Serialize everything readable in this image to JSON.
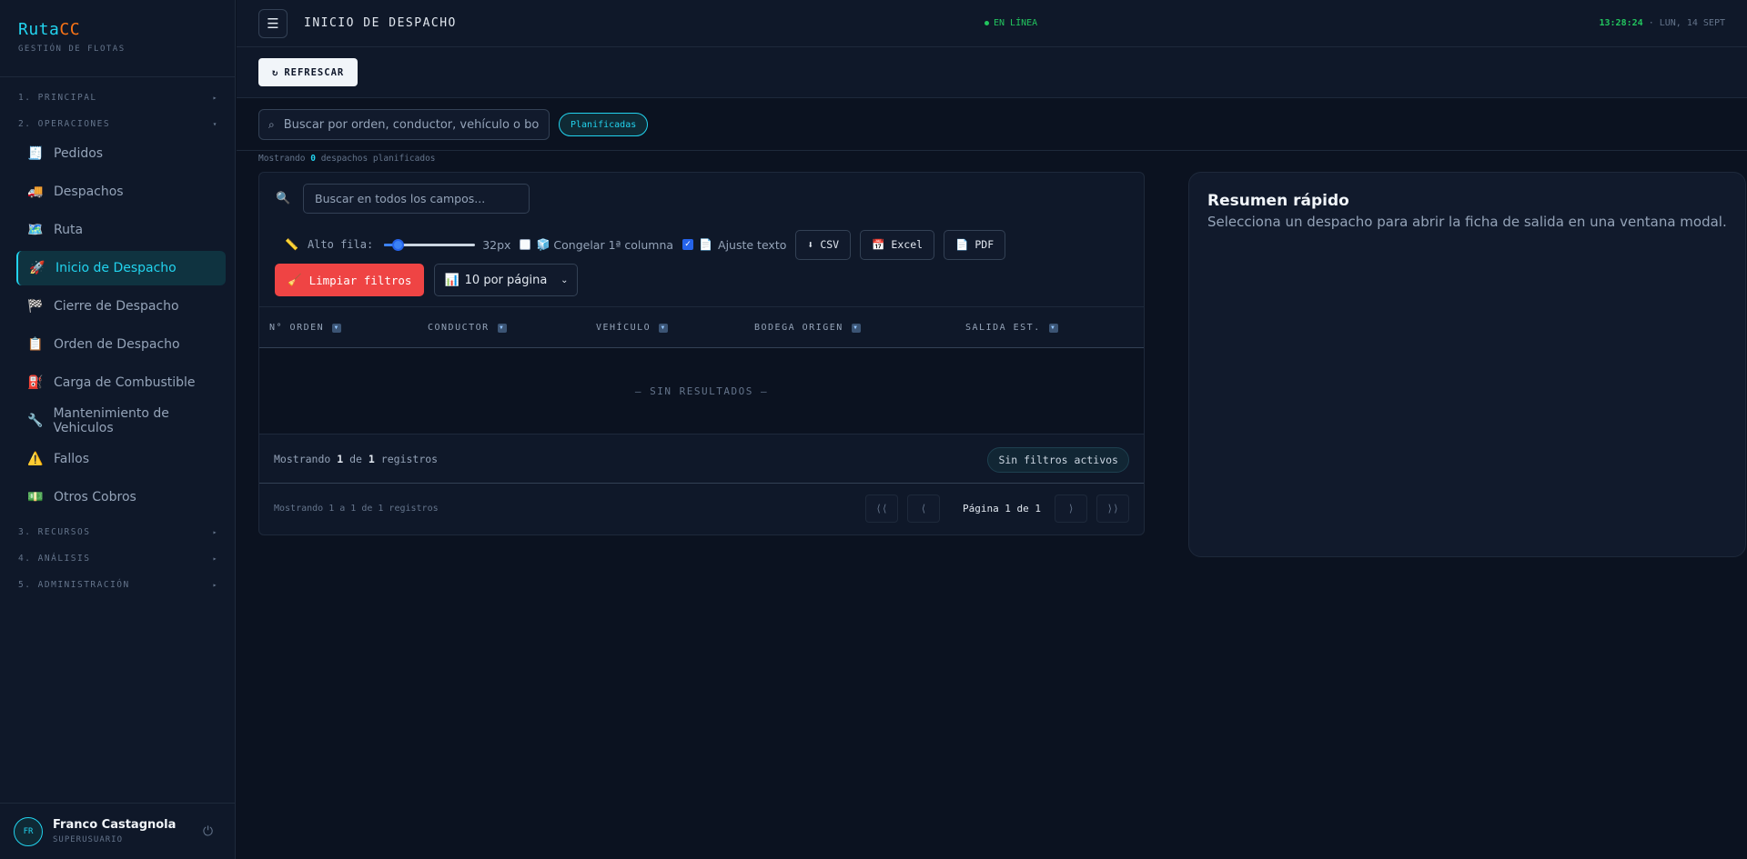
{
  "brand": {
    "name_a": "Ruta",
    "name_b": "CC",
    "subtitle": "GESTIÓN DE FLOTAS"
  },
  "sidebar": {
    "sections": [
      {
        "label": "1. PRINCIPAL",
        "arrow": "▸"
      },
      {
        "label": "2. OPERACIONES",
        "arrow": "▾"
      },
      {
        "label": "3. RECURSOS",
        "arrow": "▸"
      },
      {
        "label": "4. ANÁLISIS",
        "arrow": "▸"
      },
      {
        "label": "5. ADMINISTRACIÓN",
        "arrow": "▸"
      }
    ],
    "items": [
      {
        "label": "Pedidos",
        "icon": "🧾"
      },
      {
        "label": "Despachos",
        "icon": "🚚"
      },
      {
        "label": "Ruta",
        "icon": "🗺️"
      },
      {
        "label": "Inicio de Despacho",
        "icon": "🚀",
        "active": true
      },
      {
        "label": "Cierre de Despacho",
        "icon": "🏁"
      },
      {
        "label": "Orden de Despacho",
        "icon": "📋"
      },
      {
        "label": "Carga de Combustible",
        "icon": "⛽"
      },
      {
        "label": "Mantenimiento de Vehiculos",
        "icon": "🔧"
      },
      {
        "label": "Fallos",
        "icon": "⚠️"
      },
      {
        "label": "Otros Cobros",
        "icon": "💵"
      }
    ]
  },
  "user": {
    "initials": "FR",
    "name": "Franco Castagnola",
    "role": "SUPERUSUARIO",
    "power_icon": "⏻"
  },
  "header": {
    "menu_icon": "☰",
    "title": "INICIO DE DESPACHO",
    "status": "EN LÍNEA",
    "time": "13:28:24",
    "date": "· LUN, 14 SEPT"
  },
  "toolbar": {
    "refresh_icon": "↻",
    "refresh_label": "REFRESCAR"
  },
  "filters": {
    "search_icon": "⌕",
    "search_placeholder": "Buscar por orden, conductor, vehículo o bodega...",
    "chip": "Planificadas",
    "showing_prefix": "Mostrando",
    "showing_count": "0",
    "showing_suffix": "despachos planificados"
  },
  "table": {
    "search_icon": "🔍",
    "search_placeholder": "Buscar en todos los campos...",
    "row_height_icon": "📏",
    "row_height_label": "Alto fila:",
    "row_height_value": "32px",
    "row_height_level": 0.1,
    "freeze_icon": "🧊",
    "freeze_label": "Congelar 1ª columna",
    "freeze_checked": false,
    "wrap_icon": "📄",
    "wrap_label": "Ajuste texto",
    "wrap_checked": true,
    "export_csv_icon": "⬇",
    "export_csv": "CSV",
    "export_excel_icon": "📅",
    "export_excel": "Excel",
    "export_pdf_icon": "📄",
    "export_pdf": "PDF",
    "clear_icon": "🧹",
    "clear_label": "Limpiar filtros",
    "page_size_icon": "📊",
    "page_size": "10 por página",
    "filter_icon": "▼",
    "columns": [
      "N° ORDEN",
      "CONDUCTOR",
      "VEHÍCULO",
      "BODEGA ORIGEN",
      "SALIDA EST."
    ],
    "empty": "— SIN RESULTADOS —",
    "footer_prefix": "Mostrando",
    "footer_count": "1",
    "footer_mid": "de",
    "footer_total": "1",
    "footer_suffix": "registros",
    "no_filters": "Sin filtros activos",
    "pager_text": "Mostrando 1 a 1 de 1 registros",
    "pager_first": "⟨⟨",
    "pager_prev": "⟨",
    "pager_info": "Página 1 de 1",
    "pager_next": "⟩",
    "pager_last": "⟩⟩"
  },
  "summary": {
    "title": "Resumen rápido",
    "description": "Selecciona un despacho para abrir la ficha de salida en una ventana modal."
  }
}
